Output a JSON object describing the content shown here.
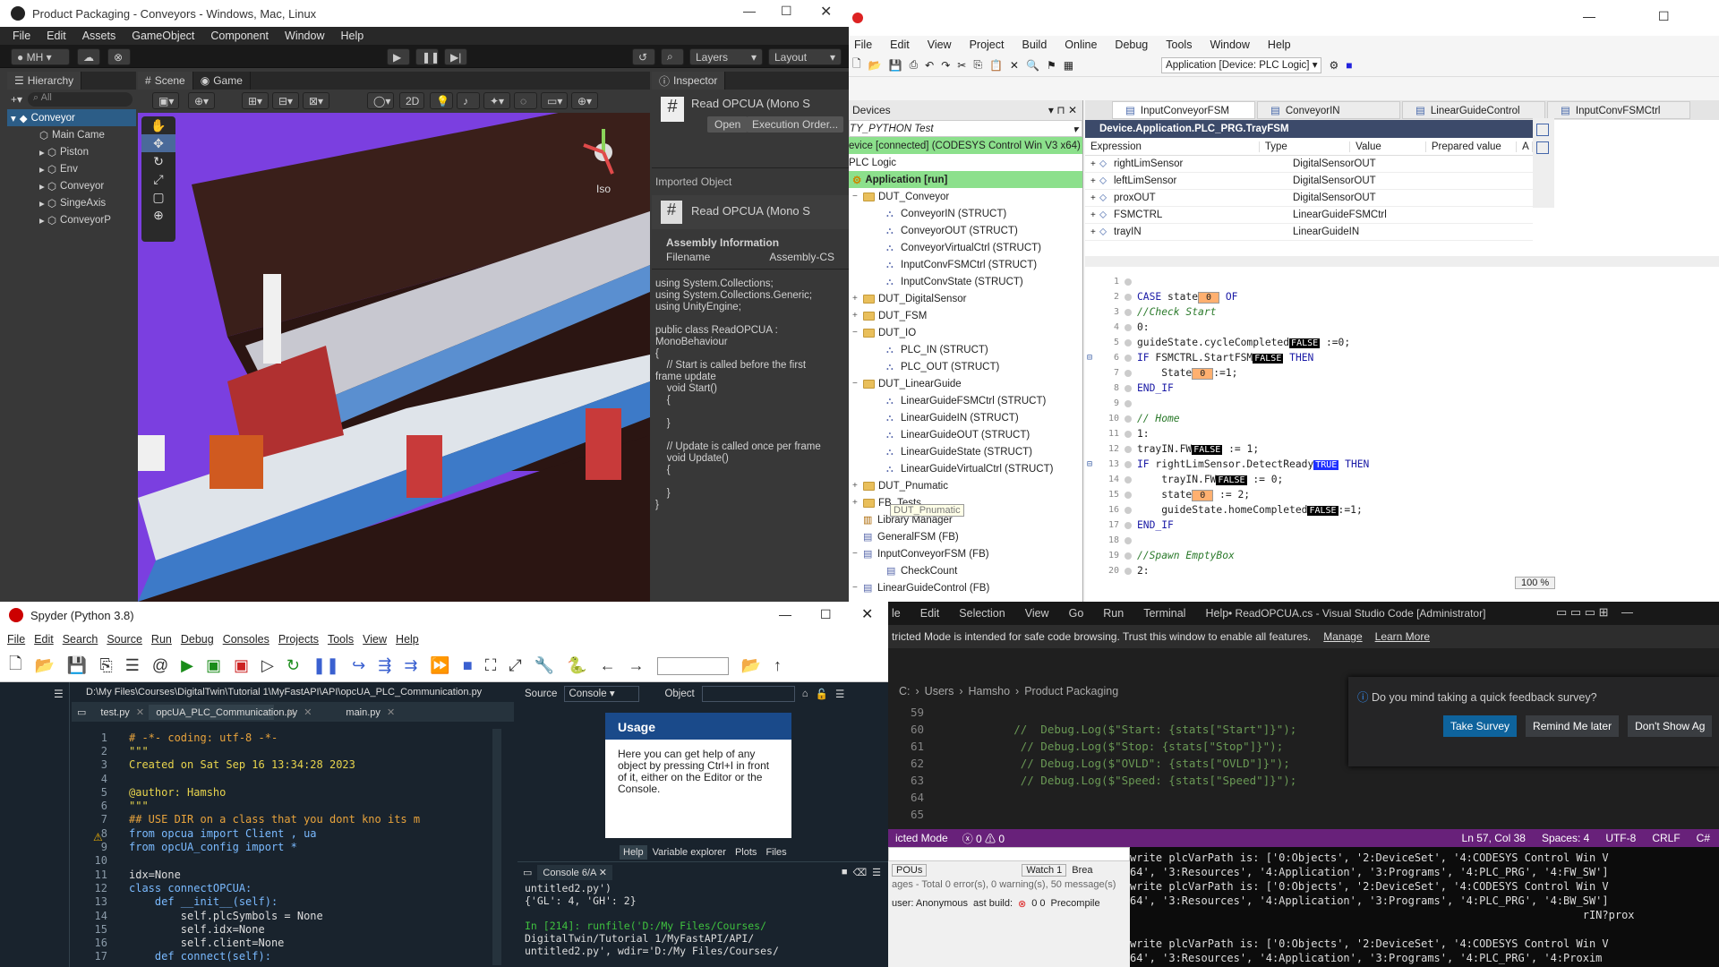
{
  "unity": {
    "title": "Product Packaging - Conveyors - Windows, Mac, Linux",
    "menu": [
      "File",
      "Edit",
      "Assets",
      "GameObject",
      "Component",
      "Window",
      "Help"
    ],
    "account": "MH",
    "layers": "Layers",
    "layout": "Layout",
    "hierarchy": {
      "tab": "Hierarchy",
      "search": "All",
      "root": "Conveyor",
      "children": [
        "Main Came",
        "Piston",
        "Env",
        "Conveyor",
        "SingeAxis",
        "ConveyorP"
      ]
    },
    "scene_tab": "Scene",
    "game_tab": "Game",
    "mode_2d": "2D",
    "iso": "Iso",
    "inspector": {
      "tab": "Inspector",
      "script_name": "Read OPCUA (Mono S",
      "open_btn": "Open",
      "exec_btn": "Execution Order...",
      "imported": "Imported Object",
      "script_name2": "Read OPCUA (Mono S",
      "assembly_info": "Assembly Information",
      "filename_label": "Filename",
      "filename_value": "Assembly-CS",
      "code": [
        "using System.Collections;",
        "using System.Collections.Generic;",
        "using UnityEngine;",
        "",
        "public class ReadOPCUA :",
        "MonoBehaviour",
        "{",
        "    // Start is called before the first",
        "frame update",
        "    void Start()",
        "    {",
        "",
        "    }",
        "",
        "    // Update is called once per frame",
        "    void Update()",
        "    {",
        "",
        "    }",
        "}"
      ]
    }
  },
  "codesys": {
    "menu": [
      "File",
      "Edit",
      "View",
      "Project",
      "Build",
      "Online",
      "Debug",
      "Tools",
      "Window",
      "Help"
    ],
    "app_combo": "Application [Device: PLC Logic]",
    "devices_title": "Devices",
    "project": "TY_PYTHON Test",
    "device": "evice [connected] (CODESYS Control Win V3 x64)",
    "plc_logic": "PLC Logic",
    "application": "Application [run]",
    "tree": [
      {
        "t": "folder",
        "label": "DUT_Conveyor",
        "l": 1,
        "x": "-"
      },
      {
        "t": "struct",
        "label": "ConveyorIN (STRUCT)",
        "l": 2
      },
      {
        "t": "struct",
        "label": "ConveyorOUT (STRUCT)",
        "l": 2
      },
      {
        "t": "struct",
        "label": "ConveyorVirtualCtrl (STRUCT)",
        "l": 2
      },
      {
        "t": "struct",
        "label": "InputConvFSMCtrl (STRUCT)",
        "l": 2
      },
      {
        "t": "struct",
        "label": "InputConvState (STRUCT)",
        "l": 2
      },
      {
        "t": "folder",
        "label": "DUT_DigitalSensor",
        "l": 1,
        "x": "+"
      },
      {
        "t": "folder",
        "label": "DUT_FSM",
        "l": 1,
        "x": "+"
      },
      {
        "t": "folder",
        "label": "DUT_IO",
        "l": 1,
        "x": "-"
      },
      {
        "t": "struct",
        "label": "PLC_IN (STRUCT)",
        "l": 2
      },
      {
        "t": "struct",
        "label": "PLC_OUT (STRUCT)",
        "l": 2
      },
      {
        "t": "folder",
        "label": "DUT_LinearGuide",
        "l": 1,
        "x": "-"
      },
      {
        "t": "struct",
        "label": "LinearGuideFSMCtrl (STRUCT)",
        "l": 2
      },
      {
        "t": "struct",
        "label": "LinearGuideIN (STRUCT)",
        "l": 2
      },
      {
        "t": "struct",
        "label": "LinearGuideOUT (STRUCT)",
        "l": 2
      },
      {
        "t": "struct",
        "label": "LinearGuideState (STRUCT)",
        "l": 2
      },
      {
        "t": "struct",
        "label": "LinearGuideVirtualCtrl (STRUCT)",
        "l": 2
      },
      {
        "t": "folder",
        "label": "DUT_Pnumatic",
        "l": 1,
        "x": "+"
      },
      {
        "t": "folder",
        "label": "FB_Tests",
        "l": 1,
        "x": "+"
      },
      {
        "t": "lib",
        "label": "Library Manager",
        "l": 1
      },
      {
        "t": "fb",
        "label": "GeneralFSM (FB)",
        "l": 1
      },
      {
        "t": "fb",
        "label": "InputConveyorFSM (FB)",
        "l": 1,
        "x": "-"
      },
      {
        "t": "fb",
        "label": "CheckCount",
        "l": 2
      },
      {
        "t": "fb",
        "label": "LinearGuideControl (FB)",
        "l": 1,
        "x": "-"
      }
    ],
    "tooltip": "DUT_Pnumatic",
    "editor_tabs": [
      "InputConveyorFSM",
      "ConveyorIN",
      "LinearGuideControl",
      "InputConvFSMCtrl"
    ],
    "watch_title": "Device.Application.PLC_PRG.TrayFSM",
    "watch_headers": [
      "Expression",
      "Type",
      "Value",
      "Prepared value",
      "A"
    ],
    "watch_rows": [
      {
        "expr": "rightLimSensor",
        "type": "DigitalSensorOUT"
      },
      {
        "expr": "leftLimSensor",
        "type": "DigitalSensorOUT"
      },
      {
        "expr": "proxOUT",
        "type": "DigitalSensorOUT"
      },
      {
        "expr": "FSMCTRL",
        "type": "LinearGuideFSMCtrl"
      },
      {
        "expr": "trayIN",
        "type": "LinearGuideIN"
      }
    ],
    "zoom": "100 %",
    "code_lines": [
      "1",
      "2",
      "3",
      "4",
      "5",
      "6",
      "7",
      "8",
      "9",
      "10",
      "11",
      "12",
      "13",
      "14",
      "15",
      "16",
      "17",
      "18",
      "19",
      "20"
    ]
  },
  "spyder": {
    "title": "Spyder (Python 3.8)",
    "menu": [
      "File",
      "Edit",
      "Search",
      "Source",
      "Run",
      "Debug",
      "Consoles",
      "Projects",
      "Tools",
      "View",
      "Help"
    ],
    "path": "D:\\My Files\\Courses\\DigitalTwin\\Tutorial 1\\MyFastAPI\\API\\opcUA_PLC_Communication.py",
    "tabs": [
      "test.py",
      "opcUA_PLC_Communication.py",
      "",
      "main.py"
    ],
    "code": [
      "# -*- coding: utf-8 -*-",
      "\"\"\"",
      "Created on Sat Sep 16 13:34:28 2023",
      "",
      "@author: Hamsho",
      "\"\"\"",
      "## USE DIR on a class that you dont kno its m",
      "from opcua import Client , ua",
      "from opcUA_config import *",
      "",
      "idx=None",
      "class connectOPCUA:",
      "    def __init__(self):",
      "        self.plcSymbols = None",
      "        self.idx=None",
      "        self.client=None",
      "    def connect(self):"
    ],
    "source_label": "Source",
    "source_value": "Console",
    "object_label": "Object",
    "usage_title": "Usage",
    "usage_text": "Here you can get help of any object by pressing Ctrl+I in front of it, either on the Editor or the Console.",
    "help_tabs": [
      "Help",
      "Variable explorer",
      "Plots",
      "Files"
    ],
    "console_tab": "Console 6/A",
    "console_lines": [
      "untitled2.py')",
      "{'GL': 4, 'GH': 2}",
      "",
      "In [214]: runfile('D:/My Files/Courses/",
      "DigitalTwin/Tutorial 1/MyFastAPI/API/",
      "untitled2.py', wdir='D:/My Files/Courses/"
    ]
  },
  "vscode": {
    "menu": [
      "le",
      "Edit",
      "Selection",
      "View",
      "Go",
      "Run",
      "Terminal",
      "Help"
    ],
    "title": "• ReadOPCUA.cs - Visual Studio Code [Administrator]",
    "restricted": "tricted Mode is intended for safe code browsing. Trust this window to enable all features.",
    "manage": "Manage",
    "learn": "Learn More",
    "breadcrumb": [
      "C:",
      "Users",
      "Hamsho",
      "Product Packaging"
    ],
    "lines": [
      {
        "n": "59",
        "code": ""
      },
      {
        "n": "60",
        "code": "        //  Debug.Log($\"Start: {stats[\"Start\"]}\");"
      },
      {
        "n": "61",
        "code": "         // Debug.Log($\"Stop: {stats[\"Stop\"]}\");"
      },
      {
        "n": "62",
        "code": "         // Debug.Log($\"OVLD\": {stats[\"OVLD\"]}\");"
      },
      {
        "n": "63",
        "code": "         // Debug.Log($\"Speed: {stats[\"Speed\"]}\");"
      },
      {
        "n": "64",
        "code": ""
      },
      {
        "n": "65",
        "code": ""
      }
    ],
    "survey": "Do you mind taking a quick feedback survey?",
    "take": "Take Survey",
    "remind": "Remind Me later",
    "dont": "Don't Show Ag",
    "status_mode": "icted Mode",
    "status_err": "ⓧ 0 ⚠ 0",
    "status_right": [
      "Ln 57, Col 38",
      "Spaces: 4",
      "UTF-8",
      "CRLF",
      "C#"
    ],
    "pous": "POUs",
    "watch1": "Watch 1",
    "brea": "Brea",
    "messages": "ages - Total 0 error(s), 0 warning(s), 50 message(s)",
    "user": "user: Anonymous",
    "last_build": "ast build:",
    "build_counts": "0  0",
    "precompile": "Precompile",
    "terminal": [
      "write plcVarPath is: ['0:Objects', '2:DeviceSet', '4:CODESYS Control Win V",
      "64', '3:Resources', '4:Application', '3:Programs', '4:PLC_PRG', '4:FW_SW']",
      "write plcVarPath is: ['0:Objects', '2:DeviceSet', '4:CODESYS Control Win V",
      "64', '3:Resources', '4:Application', '3:Programs', '4:PLC_PRG', '4:BW_SW']",
      "                                                                      rIN?prox",
      "",
      "write plcVarPath is: ['0:Objects', '2:DeviceSet', '4:CODESYS Control Win V",
      "64', '3:Resources', '4:Application', '3:Programs', '4:PLC_PRG', '4:Proxim"
    ]
  },
  "colors": {
    "unity_bg": "#383838",
    "scene_purple": "#7b3fe0",
    "codesys_green": "#8ce08c",
    "spyder_bg": "#19232d",
    "vs_purple": "#68217a",
    "vs_blue": "#0e639c"
  }
}
